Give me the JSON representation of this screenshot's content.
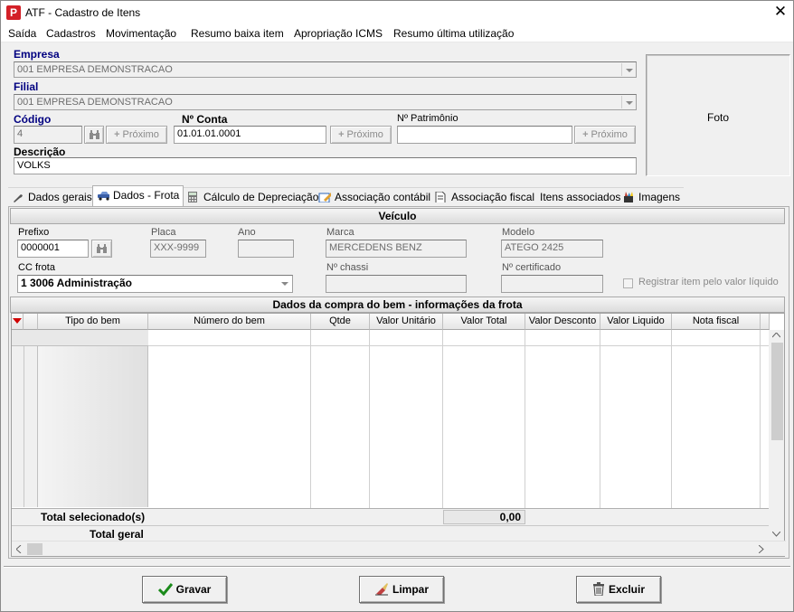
{
  "window": {
    "title": "ATF - Cadastro de Itens",
    "close_glyph": "✕",
    "app_icon_letter": "P"
  },
  "menu": [
    "Saída",
    "Cadastros",
    "Movimentação",
    "Resumo baixa item",
    "Apropriação ICMS",
    "Resumo última utilização"
  ],
  "form": {
    "empresa_label": "Empresa",
    "empresa_value": "001 EMPRESA DEMONSTRACAO",
    "filial_label": "Filial",
    "filial_value": "001 EMPRESA DEMONSTRACAO",
    "codigo_label": "Código",
    "codigo_value": "4",
    "proximo_label": "Próximo",
    "conta_label": "Nº Conta",
    "conta_value": "01.01.01.0001",
    "patrimonio_label": "Nº Patrimônio",
    "patrimonio_value": "",
    "descricao_label": "Descrição",
    "descricao_value": "VOLKS",
    "foto_label": "Foto"
  },
  "tabs": [
    {
      "label": "Dados gerais",
      "icon": "wrench-icon"
    },
    {
      "label": "Dados - Frota",
      "icon": "car-icon",
      "active": true
    },
    {
      "label": "Cálculo de Depreciação",
      "icon": "calculator-icon"
    },
    {
      "label": "Associação contábil",
      "icon": "edit-icon"
    },
    {
      "label": "Associação fiscal",
      "icon": "document-icon"
    },
    {
      "label": "Itens associados",
      "icon": ""
    },
    {
      "label": "Imagens",
      "icon": "paint-icon"
    }
  ],
  "veiculo": {
    "header": "Veículo",
    "prefixo_label": "Prefixo",
    "prefixo_value": "0000001",
    "placa_label": "Placa",
    "placa_value": "XXX-9999",
    "ano_label": "Ano",
    "ano_value": "",
    "marca_label": "Marca",
    "marca_value": "MERCEDENS BENZ",
    "modelo_label": "Modelo",
    "modelo_value": "ATEGO 2425",
    "ccfrota_label": "CC frota",
    "ccfrota_value": "1 3006 Administração",
    "chassi_label": "Nº chassi",
    "chassi_value": "",
    "certificado_label": "Nº certificado",
    "certificado_value": "",
    "registrar_label": "Registrar item pelo valor líquido"
  },
  "grid": {
    "header": "Dados da compra do bem - informações da frota",
    "columns": [
      "Tipo do bem",
      "Número do bem",
      "Qtde",
      "Valor Unitário",
      "Valor Total",
      "Valor Desconto",
      "Valor Liquido",
      "Nota fiscal"
    ],
    "total_selecionado_label": "Total selecionado(s)",
    "total_selecionado_value": "0,00",
    "total_geral_label": "Total geral"
  },
  "buttons": {
    "gravar": "Gravar",
    "limpar": "Limpar",
    "excluir": "Excluir"
  }
}
